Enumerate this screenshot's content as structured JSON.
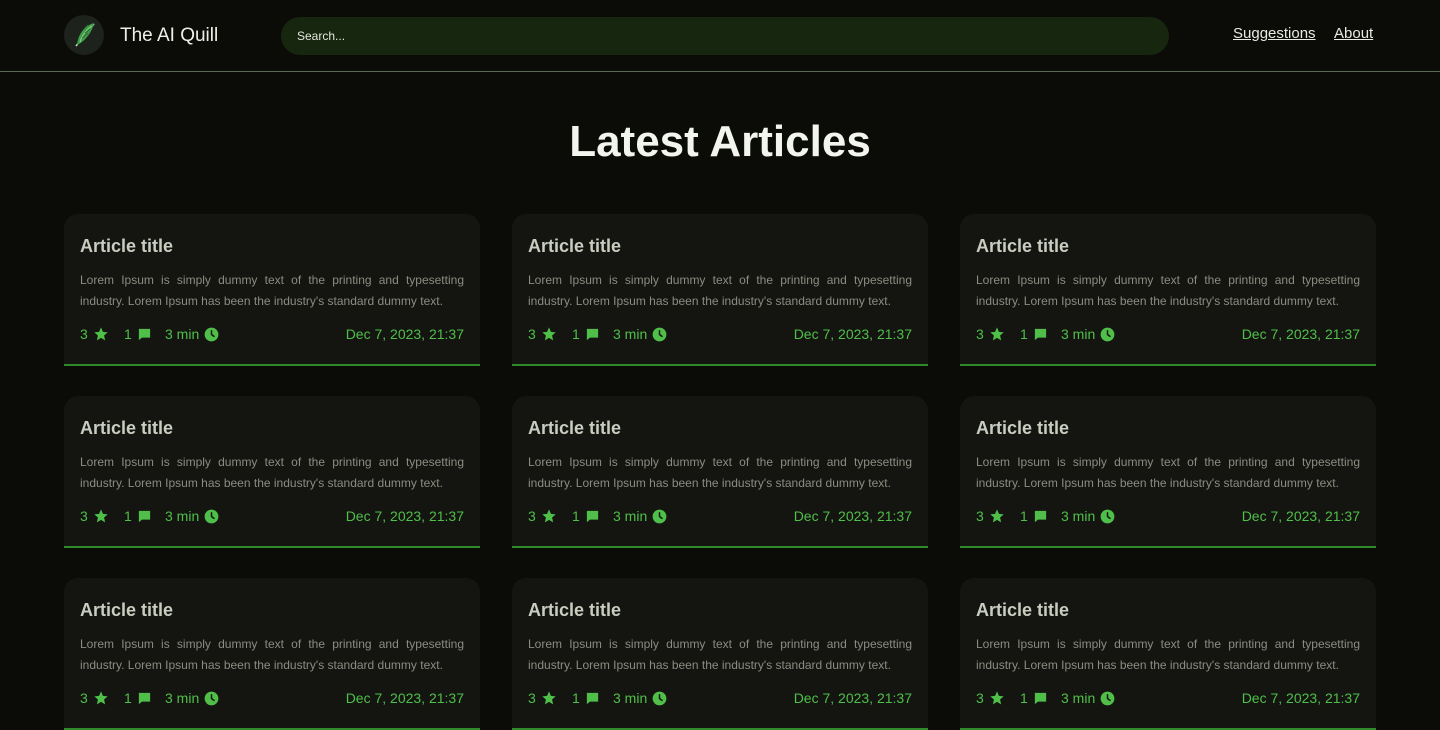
{
  "header": {
    "brand": "The AI Quill",
    "search_placeholder": "Search...",
    "nav": {
      "suggestions": "Suggestions",
      "about": "About"
    }
  },
  "main": {
    "title": "Latest Articles",
    "articles": [
      {
        "title": "Article title",
        "excerpt": "Lorem Ipsum is simply dummy text of the printing and typesetting industry. Lorem Ipsum has been the industry's standard dummy text.",
        "stars": "3",
        "comments": "1",
        "read_time": "3 min",
        "date": "Dec 7, 2023, 21:37"
      },
      {
        "title": "Article title",
        "excerpt": "Lorem Ipsum is simply dummy text of the printing and typesetting industry. Lorem Ipsum has been the industry's standard dummy text.",
        "stars": "3",
        "comments": "1",
        "read_time": "3 min",
        "date": "Dec 7, 2023, 21:37"
      },
      {
        "title": "Article title",
        "excerpt": "Lorem Ipsum is simply dummy text of the printing and typesetting industry. Lorem Ipsum has been the industry's standard dummy text.",
        "stars": "3",
        "comments": "1",
        "read_time": "3 min",
        "date": "Dec 7, 2023, 21:37"
      },
      {
        "title": "Article title",
        "excerpt": "Lorem Ipsum is simply dummy text of the printing and typesetting industry. Lorem Ipsum has been the industry's standard dummy text.",
        "stars": "3",
        "comments": "1",
        "read_time": "3 min",
        "date": "Dec 7, 2023, 21:37"
      },
      {
        "title": "Article title",
        "excerpt": "Lorem Ipsum is simply dummy text of the printing and typesetting industry. Lorem Ipsum has been the industry's standard dummy text.",
        "stars": "3",
        "comments": "1",
        "read_time": "3 min",
        "date": "Dec 7, 2023, 21:37"
      },
      {
        "title": "Article title",
        "excerpt": "Lorem Ipsum is simply dummy text of the printing and typesetting industry. Lorem Ipsum has been the industry's standard dummy text.",
        "stars": "3",
        "comments": "1",
        "read_time": "3 min",
        "date": "Dec 7, 2023, 21:37"
      },
      {
        "title": "Article title",
        "excerpt": "Lorem Ipsum is simply dummy text of the printing and typesetting industry. Lorem Ipsum has been the industry's standard dummy text.",
        "stars": "3",
        "comments": "1",
        "read_time": "3 min",
        "date": "Dec 7, 2023, 21:37"
      },
      {
        "title": "Article title",
        "excerpt": "Lorem Ipsum is simply dummy text of the printing and typesetting industry. Lorem Ipsum has been the industry's standard dummy text.",
        "stars": "3",
        "comments": "1",
        "read_time": "3 min",
        "date": "Dec 7, 2023, 21:37"
      },
      {
        "title": "Article title",
        "excerpt": "Lorem Ipsum is simply dummy text of the printing and typesetting industry. Lorem Ipsum has been the industry's standard dummy text.",
        "stars": "3",
        "comments": "1",
        "read_time": "3 min",
        "date": "Dec 7, 2023, 21:37"
      }
    ]
  },
  "icons": {
    "logo": "quill-icon",
    "stars": "star-icon",
    "comments": "comment-icon",
    "time": "clock-icon"
  },
  "colors": {
    "background": "#0b0c08",
    "card": "#141510",
    "accent": "#4fbf4a",
    "search_bg": "#16260f"
  }
}
